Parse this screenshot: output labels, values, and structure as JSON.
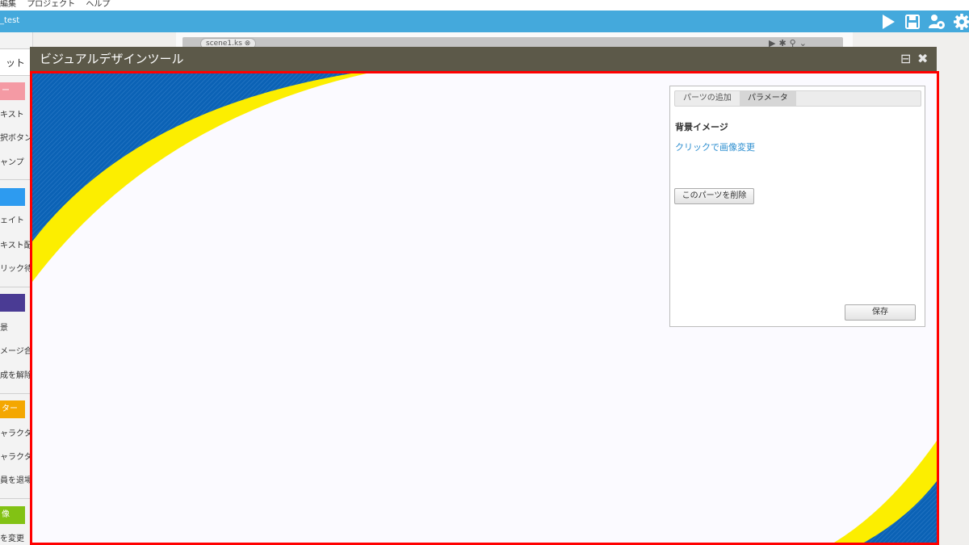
{
  "menu": [
    "編集",
    "プロジェクト",
    "ヘルプ"
  ],
  "header": {
    "project_title": "_test",
    "icons": [
      "play-icon",
      "save-icon",
      "users-gear-icon",
      "gear-icon"
    ]
  },
  "sidebar": {
    "tab_label": "ット",
    "categories": [
      {
        "label": "ー",
        "color": "#f49aa4",
        "items": [
          "キスト",
          "択ボタン",
          "ャンプ"
        ]
      },
      {
        "label": "",
        "color": "#2d9bf0",
        "items": [
          "ェイト",
          "キスト配置",
          "リック待ち"
        ]
      },
      {
        "label": "",
        "color": "#4a3b94",
        "items": [
          "景",
          "メージ合成",
          "成を解除"
        ]
      },
      {
        "label": "ター",
        "color": "#f4a700",
        "items": [
          "ャラクター",
          "ャラクター",
          "員を退場"
        ]
      },
      {
        "label": "像",
        "color": "#82c214",
        "items": [
          "を変更"
        ]
      }
    ]
  },
  "scene_tab": {
    "label": "scene1.ks"
  },
  "modal": {
    "title": "ビジュアルデザインツール",
    "colors": {
      "blue": "#0b62b5",
      "yellow": "#fcee00",
      "border": "#ff0000"
    }
  },
  "panel": {
    "tabs": [
      "パーツの追加",
      "パラメータ"
    ],
    "active_tab": "パラメータ",
    "section_label": "背景イメージ",
    "change_image_link": "クリックで画像変更",
    "delete_button": "このパーツを削除",
    "save_button": "保存"
  }
}
